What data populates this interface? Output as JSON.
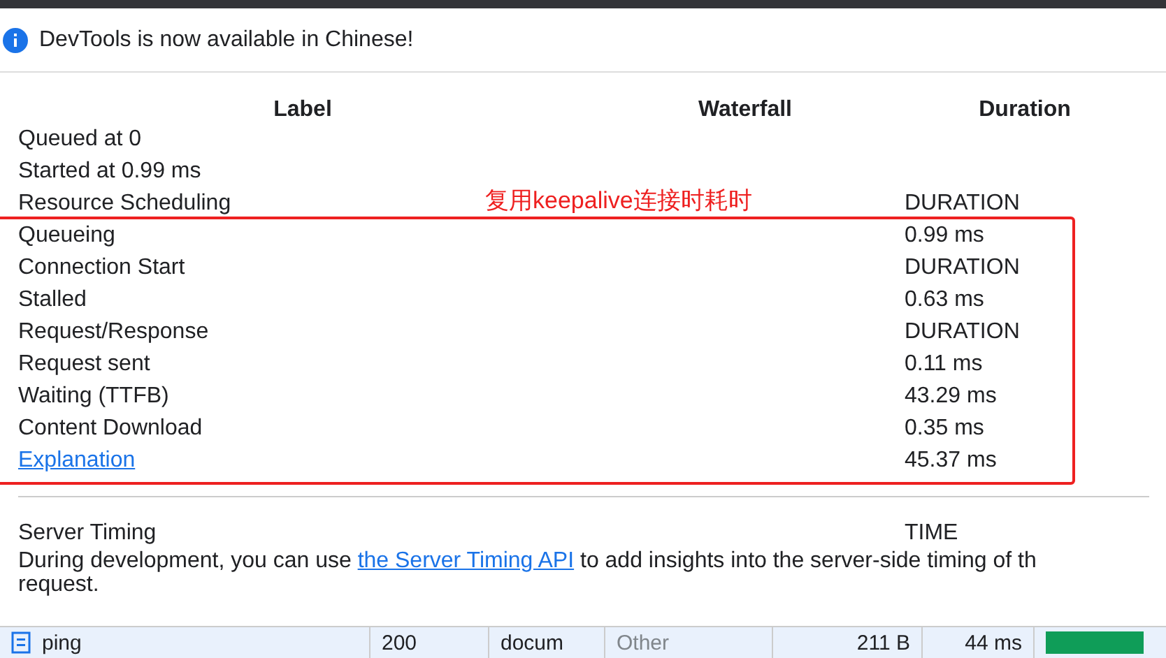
{
  "banner": {
    "text": "DevTools is now available in Chinese!"
  },
  "timing_table": {
    "columns": [
      "Label",
      "Waterfall",
      "Duration"
    ],
    "rows": [
      {
        "kind": "text",
        "label": "Queued at 0",
        "duration": ""
      },
      {
        "kind": "text",
        "label": "Started at 0.99 ms",
        "duration": ""
      },
      {
        "kind": "text",
        "label": "Resource Scheduling",
        "duration": "DURATION"
      },
      {
        "kind": "text",
        "label": "Queueing",
        "duration": "0.99 ms"
      },
      {
        "kind": "text",
        "label": "Connection Start",
        "duration": "DURATION"
      },
      {
        "kind": "text",
        "label": "Stalled",
        "duration": "0.63 ms"
      },
      {
        "kind": "text",
        "label": "Request/Response",
        "duration": "DURATION"
      },
      {
        "kind": "text",
        "label": "Request sent",
        "duration": "0.11 ms"
      },
      {
        "kind": "text",
        "label": "Waiting (TTFB)",
        "duration": "43.29 ms"
      },
      {
        "kind": "text",
        "label": "Content Download",
        "duration": "0.35 ms"
      },
      {
        "kind": "link",
        "label": "Explanation",
        "duration": "45.37 ms"
      }
    ],
    "annotation": "复用keepalive连接时耗时"
  },
  "server_timing": {
    "label": "Server Timing",
    "duration": "TIME",
    "text_before": "During development, you can use ",
    "link": "the Server Timing API",
    "text_after": " to add insights into the server-side timing of th",
    "text_continued": "request."
  },
  "request_row": {
    "cells": [
      "ping",
      "200",
      "docum",
      "Other",
      "211 B",
      "44 ms"
    ]
  }
}
